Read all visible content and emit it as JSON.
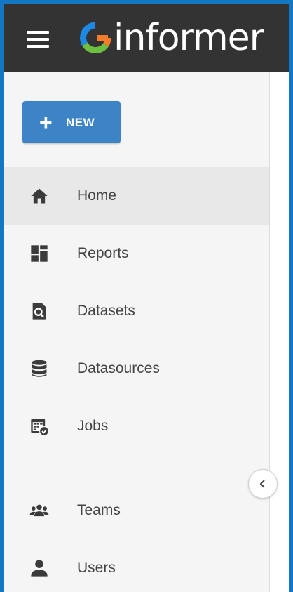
{
  "app": {
    "name": "informer"
  },
  "toolbar": {
    "menu_icon": "hamburger-menu-icon"
  },
  "new_button": {
    "plus": "+",
    "label": "NEW"
  },
  "nav": [
    {
      "label": "Home",
      "icon": "home-icon"
    },
    {
      "label": "Reports",
      "icon": "reports-icon"
    },
    {
      "label": "Datasets",
      "icon": "datasets-icon"
    },
    {
      "label": "Datasources",
      "icon": "database-icon"
    },
    {
      "label": "Jobs",
      "icon": "jobs-icon"
    },
    {
      "label": "Teams",
      "icon": "teams-icon"
    },
    {
      "label": "Users",
      "icon": "user-icon"
    }
  ],
  "collapse": {
    "icon": "chevron-left-icon"
  },
  "colors": {
    "frame": "#1377c4",
    "topbar": "#333333",
    "sidebar": "#f5f5f5",
    "active_item": "#e8e8e8",
    "primary_button": "#3d84c6",
    "text": "#444444",
    "logo_green": "#6cbf3f",
    "logo_blue": "#1e88e5",
    "logo_orange": "#f57c2b"
  }
}
